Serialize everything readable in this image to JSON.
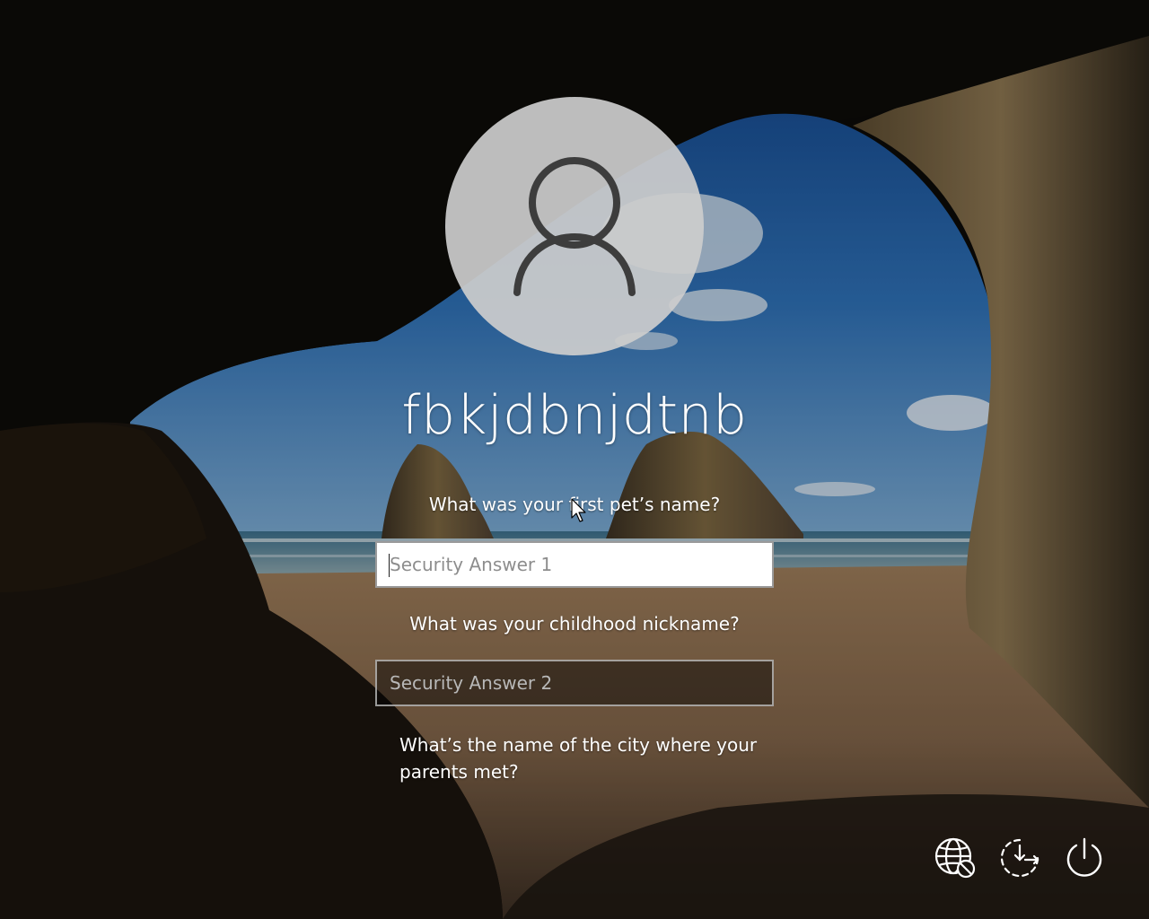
{
  "screen": {
    "type": "Windows sign-in security questions",
    "background": "sea cave with sandy beach and rock stacks"
  },
  "user": {
    "name": "fbkjdbnjdtnb",
    "avatar_icon": "user-silhouette-icon"
  },
  "security": {
    "question_1": "What was your first pet’s name?",
    "answer_1_placeholder": "Security Answer 1",
    "answer_1_value": "",
    "question_2": "What was your childhood nickname?",
    "answer_2_placeholder": "Security Answer 2",
    "answer_2_value": "",
    "question_3": "What’s the name of the city where your parents met?"
  },
  "corner_buttons": [
    {
      "icon": "network-disconnected-icon",
      "label": "Network"
    },
    {
      "icon": "ease-of-access-icon",
      "label": "Ease of Access"
    },
    {
      "icon": "power-icon",
      "label": "Power"
    }
  ],
  "colors": {
    "text": "#ffffff",
    "active_field_bg": "#ffffff",
    "inactive_field_border": "#c8c8c8"
  }
}
